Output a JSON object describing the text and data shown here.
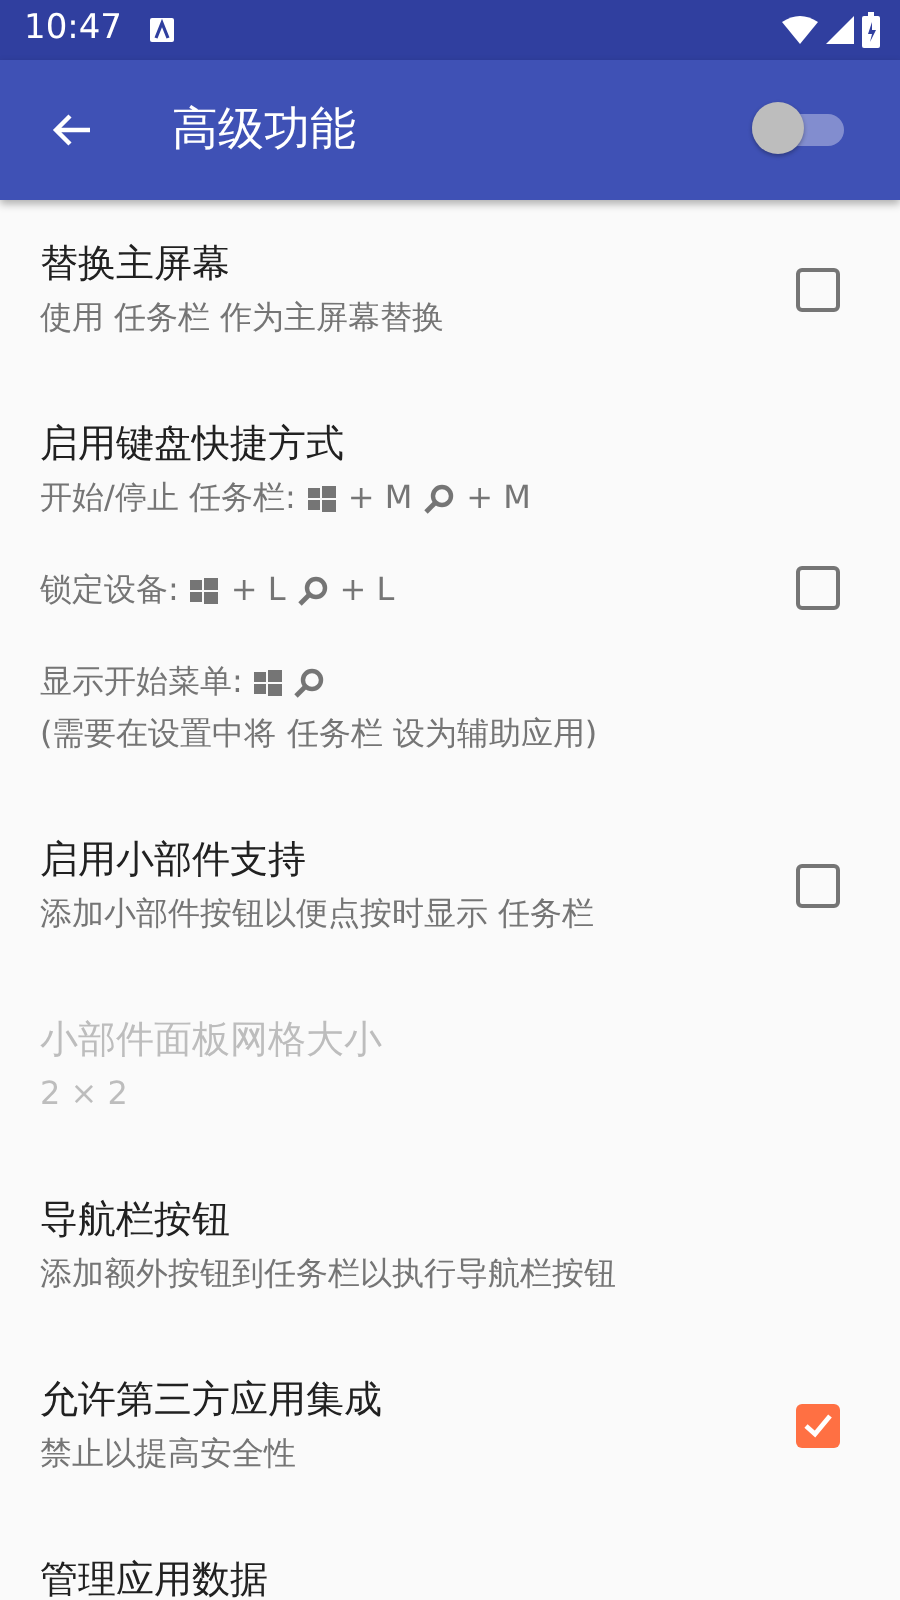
{
  "status_bar": {
    "time": "10:47"
  },
  "app_bar": {
    "title": "高级功能",
    "master_switch": {
      "on": false
    }
  },
  "items": [
    {
      "title": "替换主屏幕",
      "disabled": false,
      "checkbox": {
        "checked": false
      },
      "summary": [
        [
          [
            {
              "kind": "text",
              "text": "使用 任务栏 作为主屏幕替换"
            }
          ]
        ]
      ]
    },
    {
      "title": "启用键盘快捷方式",
      "disabled": false,
      "checkbox": {
        "checked": false
      },
      "summary": [
        [
          [
            {
              "kind": "text",
              "text": "开始/停止 任务栏:"
            },
            {
              "kind": "win-key"
            },
            {
              "kind": "text",
              "text": "+ M"
            },
            {
              "kind": "search-key"
            },
            {
              "kind": "text",
              "text": "+ M"
            }
          ]
        ],
        [
          [
            {
              "kind": "text",
              "text": "锁定设备:"
            },
            {
              "kind": "win-key"
            },
            {
              "kind": "text",
              "text": "+ L"
            },
            {
              "kind": "search-key"
            },
            {
              "kind": "text",
              "text": "+ L"
            }
          ]
        ],
        [
          [
            {
              "kind": "text",
              "text": "显示开始菜单:"
            },
            {
              "kind": "win-key"
            },
            {
              "kind": "search-key"
            }
          ],
          [
            {
              "kind": "text",
              "text": "(需要在设置中将 任务栏 设为辅助应用)"
            }
          ]
        ]
      ]
    },
    {
      "title": "启用小部件支持",
      "disabled": false,
      "checkbox": {
        "checked": false
      },
      "summary": [
        [
          [
            {
              "kind": "text",
              "text": "添加小部件按钮以便点按时显示 任务栏"
            }
          ]
        ]
      ]
    },
    {
      "title": "小部件面板网格大小",
      "disabled": true,
      "summary": [
        [
          [
            {
              "kind": "text",
              "text": "2 × 2"
            }
          ]
        ]
      ]
    },
    {
      "title": "导航栏按钮",
      "disabled": false,
      "summary": [
        [
          [
            {
              "kind": "text",
              "text": "添加额外按钮到任务栏以执行导航栏按钮"
            }
          ]
        ]
      ]
    },
    {
      "title": "允许第三方应用集成",
      "disabled": false,
      "checkbox": {
        "checked": true
      },
      "summary": [
        [
          [
            {
              "kind": "text",
              "text": "禁止以提高安全性"
            }
          ]
        ]
      ]
    },
    {
      "title": "管理应用数据",
      "disabled": false
    }
  ]
}
